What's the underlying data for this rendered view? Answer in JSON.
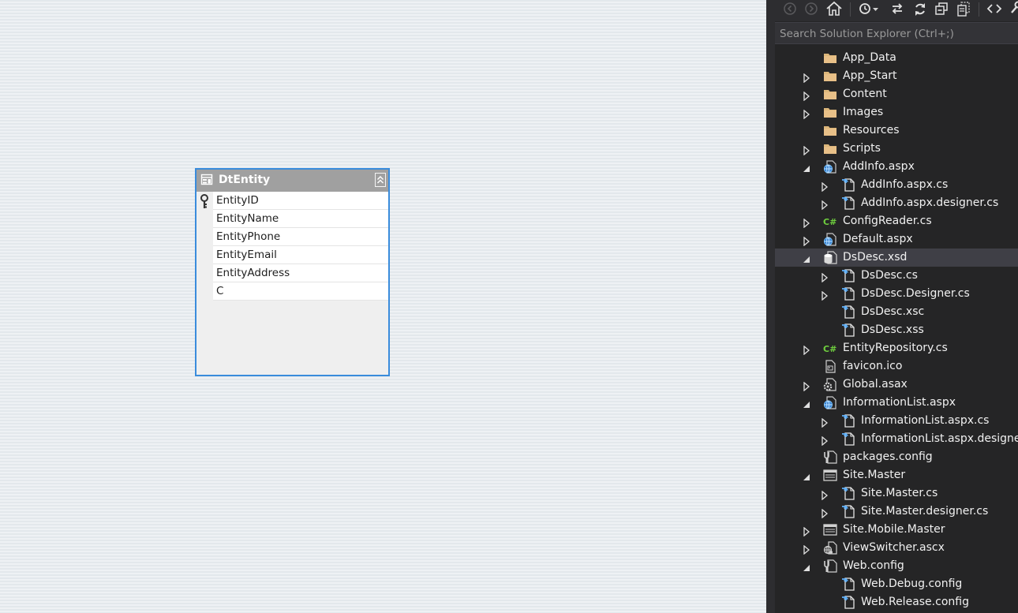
{
  "table": {
    "name": "DtEntity",
    "columns": [
      "EntityID",
      "EntityName",
      "EntityPhone",
      "EntityEmail",
      "EntityAddress",
      "C"
    ]
  },
  "search": {
    "placeholder": "Search Solution Explorer (Ctrl+;)"
  },
  "toolbar": {
    "buttons": [
      "back-icon",
      "forward-icon",
      "home-icon",
      "pending-changes-icon",
      "dropdown-arrow-icon",
      "sync-icon",
      "refresh-icon",
      "collapse-all-icon",
      "show-all-files-icon",
      "view-code-icon",
      "properties-icon"
    ]
  },
  "tree": [
    {
      "label": "App_Data",
      "level": 0,
      "arrow": "none",
      "icon": "folder"
    },
    {
      "label": "App_Start",
      "level": 0,
      "arrow": "collapsed",
      "icon": "folder"
    },
    {
      "label": "Content",
      "level": 0,
      "arrow": "collapsed",
      "icon": "folder"
    },
    {
      "label": "Images",
      "level": 0,
      "arrow": "collapsed",
      "icon": "folder"
    },
    {
      "label": "Resources",
      "level": 0,
      "arrow": "none",
      "icon": "folder"
    },
    {
      "label": "Scripts",
      "level": 0,
      "arrow": "collapsed",
      "icon": "folder"
    },
    {
      "label": "AddInfo.aspx",
      "level": 0,
      "arrow": "expanded",
      "icon": "web-page"
    },
    {
      "label": "AddInfo.aspx.cs",
      "level": 1,
      "arrow": "collapsed",
      "icon": "code-file"
    },
    {
      "label": "AddInfo.aspx.designer.cs",
      "level": 1,
      "arrow": "collapsed",
      "icon": "code-file"
    },
    {
      "label": "ConfigReader.cs",
      "level": 0,
      "arrow": "collapsed",
      "icon": "csharp"
    },
    {
      "label": "Default.aspx",
      "level": 0,
      "arrow": "collapsed",
      "icon": "web-page"
    },
    {
      "label": "DsDesc.xsd",
      "level": 0,
      "arrow": "expanded",
      "icon": "dataset",
      "selected": true
    },
    {
      "label": "DsDesc.cs",
      "level": 1,
      "arrow": "collapsed",
      "icon": "code-file"
    },
    {
      "label": "DsDesc.Designer.cs",
      "level": 1,
      "arrow": "collapsed",
      "icon": "code-file"
    },
    {
      "label": "DsDesc.xsc",
      "level": 1,
      "arrow": "none",
      "icon": "code-file"
    },
    {
      "label": "DsDesc.xss",
      "level": 1,
      "arrow": "none",
      "icon": "code-file"
    },
    {
      "label": "EntityRepository.cs",
      "level": 0,
      "arrow": "collapsed",
      "icon": "csharp"
    },
    {
      "label": "favicon.ico",
      "level": 0,
      "arrow": "none",
      "icon": "image-file"
    },
    {
      "label": "Global.asax",
      "level": 0,
      "arrow": "collapsed",
      "icon": "global-asax"
    },
    {
      "label": "InformationList.aspx",
      "level": 0,
      "arrow": "expanded",
      "icon": "web-page"
    },
    {
      "label": "InformationList.aspx.cs",
      "level": 1,
      "arrow": "collapsed",
      "icon": "code-file"
    },
    {
      "label": "InformationList.aspx.designer.cs",
      "level": 1,
      "arrow": "collapsed",
      "icon": "code-file"
    },
    {
      "label": "packages.config",
      "level": 0,
      "arrow": "none",
      "icon": "config"
    },
    {
      "label": "Site.Master",
      "level": 0,
      "arrow": "expanded",
      "icon": "master-page"
    },
    {
      "label": "Site.Master.cs",
      "level": 1,
      "arrow": "collapsed",
      "icon": "code-file"
    },
    {
      "label": "Site.Master.designer.cs",
      "level": 1,
      "arrow": "collapsed",
      "icon": "code-file"
    },
    {
      "label": "Site.Mobile.Master",
      "level": 0,
      "arrow": "collapsed",
      "icon": "master-page"
    },
    {
      "label": "ViewSwitcher.ascx",
      "level": 0,
      "arrow": "collapsed",
      "icon": "user-control"
    },
    {
      "label": "Web.config",
      "level": 0,
      "arrow": "expanded",
      "icon": "config"
    },
    {
      "label": "Web.Debug.config",
      "level": 1,
      "arrow": "none",
      "icon": "code-file"
    },
    {
      "label": "Web.Release.config",
      "level": 1,
      "arrow": "none",
      "icon": "code-file"
    }
  ]
}
